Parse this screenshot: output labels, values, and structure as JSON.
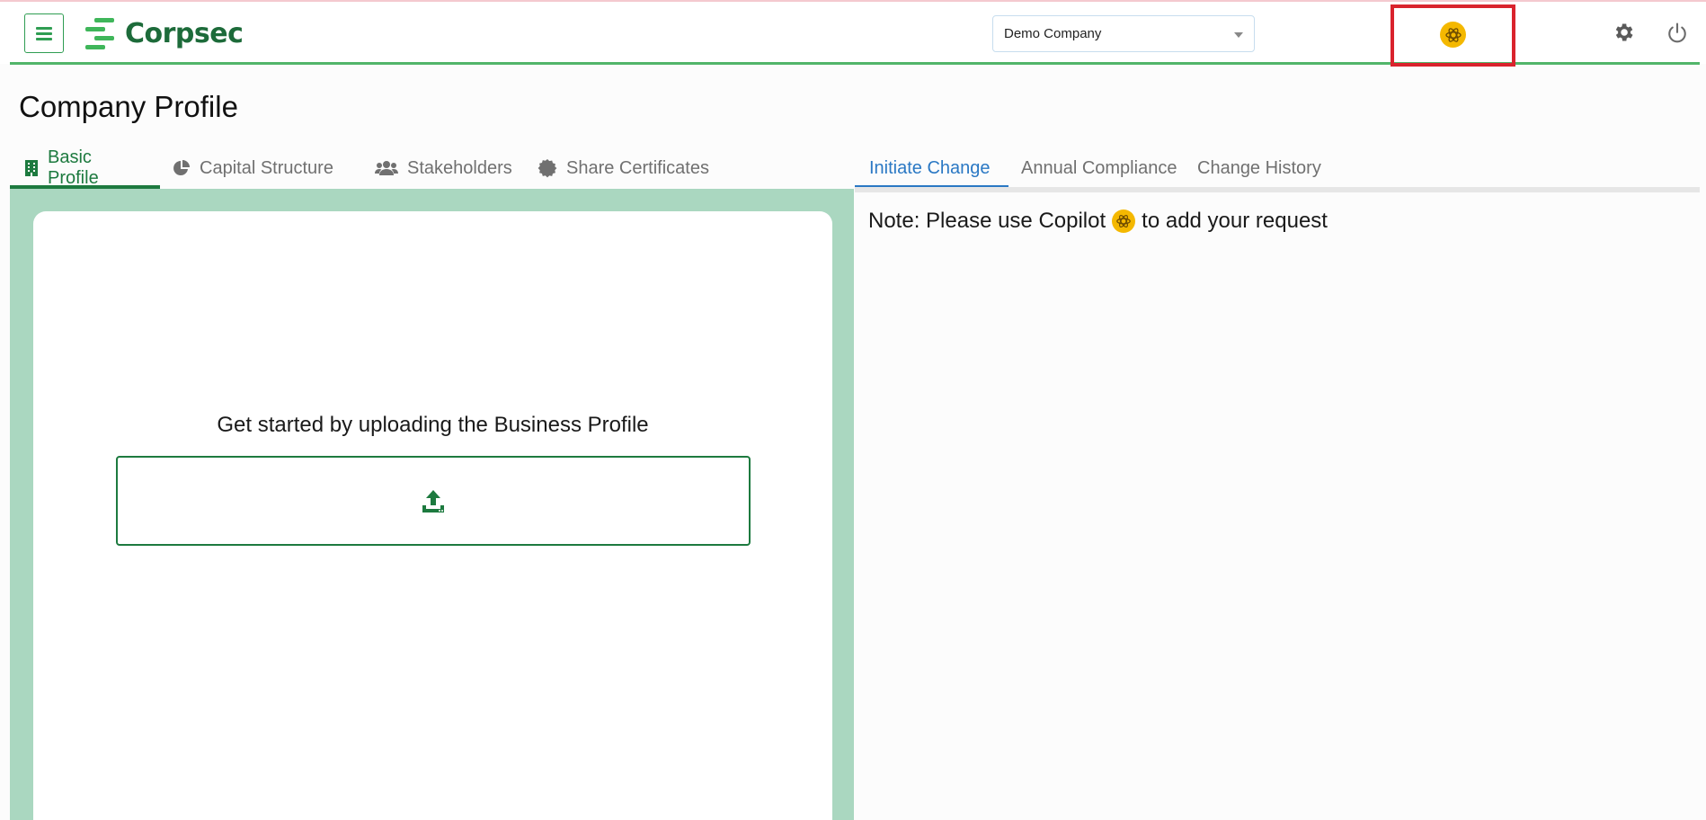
{
  "header": {
    "menu_icon": "hamburger-menu-icon",
    "logo_text": "Corpsec",
    "company_select": {
      "value": "Demo Company"
    },
    "copilot_icon": "copilot-icon",
    "settings_icon": "gear-icon",
    "logout_icon": "power-icon"
  },
  "page": {
    "title": "Company Profile"
  },
  "left_tabs": [
    {
      "label": "Basic Profile",
      "icon": "building-icon",
      "active": true
    },
    {
      "label": "Capital Structure",
      "icon": "pie-chart-icon",
      "active": false
    },
    {
      "label": "Stakeholders",
      "icon": "users-icon",
      "active": false
    },
    {
      "label": "Share Certificates",
      "icon": "certificate-icon",
      "active": false
    }
  ],
  "basic_profile": {
    "prompt": "Get started by uploading the Business Profile",
    "upload_icon": "upload-icon"
  },
  "right_tabs": [
    {
      "label": "Initiate Change",
      "active": true
    },
    {
      "label": "Annual Compliance",
      "active": false
    },
    {
      "label": "Change History",
      "active": false
    }
  ],
  "initiate_change": {
    "note_before": "Note: Please use Copilot",
    "note_after": "to add your request"
  },
  "colors": {
    "brand_green": "#1d7a3f",
    "accent_green": "#3fb65a",
    "panel_green": "#aad7c0",
    "active_blue": "#2a78c4",
    "copilot_yellow": "#f4b800",
    "highlight_red": "#d9232d"
  }
}
